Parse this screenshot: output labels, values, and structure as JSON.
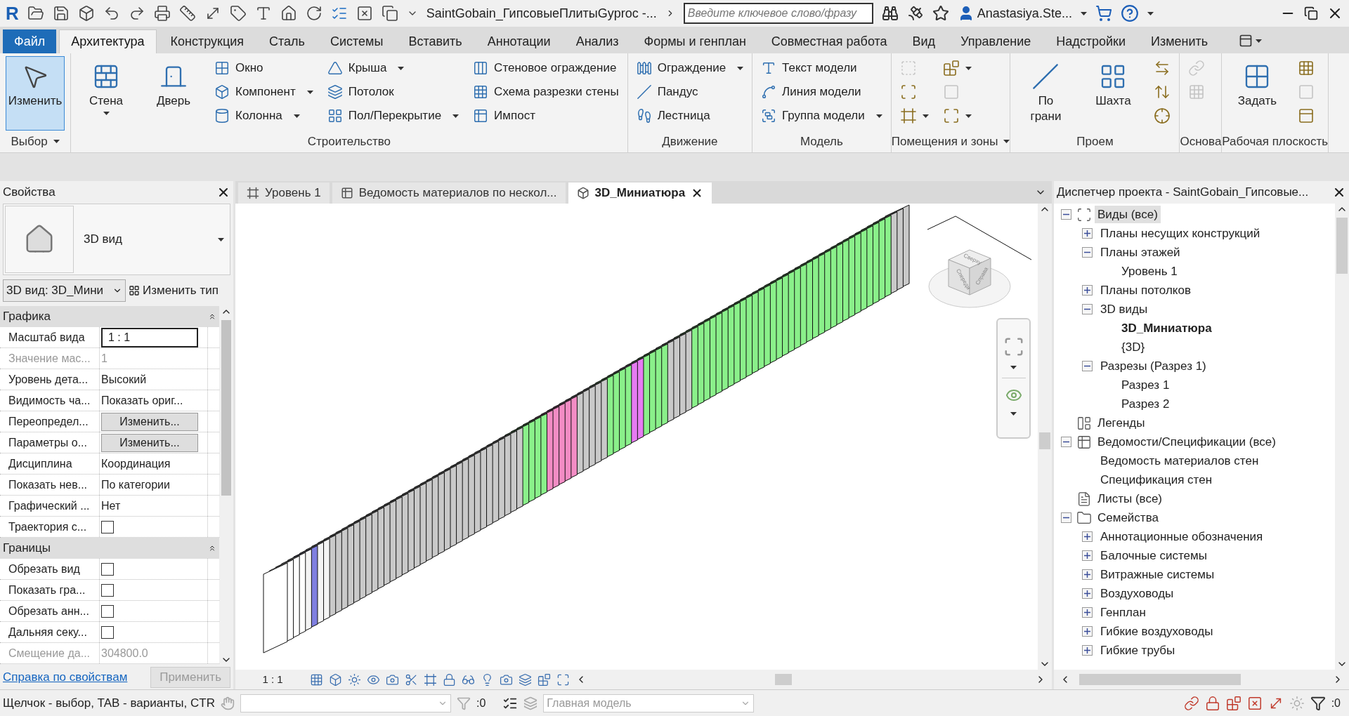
{
  "title_bar": {
    "app_logo": "R",
    "document": "SaintGobain_ГипсовыеПлитыGyproc -...",
    "search": {
      "placeholder": "Введите ключевое слово/фразу"
    },
    "user": "Anastasiya.Ste..."
  },
  "ribbon_tabs": [
    {
      "label": "Файл",
      "kind": "file",
      "selected": false
    },
    {
      "label": "Архитектура",
      "kind": "tab",
      "selected": true
    },
    {
      "label": "Конструкция",
      "kind": "tab",
      "selected": false
    },
    {
      "label": "Сталь",
      "kind": "tab",
      "selected": false
    },
    {
      "label": "Системы",
      "kind": "tab",
      "selected": false
    },
    {
      "label": "Вставить",
      "kind": "tab",
      "selected": false
    },
    {
      "label": "Аннотации",
      "kind": "tab",
      "selected": false
    },
    {
      "label": "Анализ",
      "kind": "tab",
      "selected": false
    },
    {
      "label": "Формы и генплан",
      "kind": "tab",
      "selected": false
    },
    {
      "label": "Совместная работа",
      "kind": "tab",
      "selected": false
    },
    {
      "label": "Вид",
      "kind": "tab",
      "selected": false
    },
    {
      "label": "Управление",
      "kind": "tab",
      "selected": false
    },
    {
      "label": "Надстройки",
      "kind": "tab",
      "selected": false
    },
    {
      "label": "Изменить",
      "kind": "tab",
      "selected": false
    }
  ],
  "ribbon_panels": [
    {
      "title": "Выбор",
      "menu": true,
      "tools": [
        {
          "label": "Изменить",
          "kind": "large",
          "dropdown": false,
          "active": true,
          "disabled": false
        }
      ]
    },
    {
      "title": "Строительство",
      "menu": false,
      "tools": [
        {
          "label": "Стена",
          "kind": "large",
          "dropdown": true,
          "active": false,
          "disabled": false
        },
        {
          "label": "Дверь",
          "kind": "large",
          "dropdown": false,
          "active": false,
          "disabled": false
        },
        {
          "label": "Окно",
          "kind": "small",
          "dropdown": false,
          "active": false,
          "disabled": false
        },
        {
          "label": "Компонент",
          "kind": "small",
          "dropdown": true,
          "active": false,
          "disabled": false
        },
        {
          "label": "Колонна",
          "kind": "small",
          "dropdown": true,
          "active": false,
          "disabled": false
        },
        {
          "label": "Крыша",
          "kind": "small",
          "dropdown": true,
          "active": false,
          "disabled": false
        },
        {
          "label": "Потолок",
          "kind": "small",
          "dropdown": false,
          "active": false,
          "disabled": false
        },
        {
          "label": "Пол/Перекрытие",
          "kind": "small",
          "dropdown": true,
          "active": false,
          "disabled": false
        },
        {
          "label": "Стеновое ограждение",
          "kind": "small",
          "dropdown": false,
          "active": false,
          "disabled": false
        },
        {
          "label": "Схема разрезки стены",
          "kind": "small",
          "dropdown": false,
          "active": false,
          "disabled": false
        },
        {
          "label": "Импост",
          "kind": "small",
          "dropdown": false,
          "active": false,
          "disabled": false
        }
      ]
    },
    {
      "title": "Движение",
      "menu": false,
      "tools": [
        {
          "label": "Ограждение",
          "kind": "small",
          "dropdown": true,
          "active": false,
          "disabled": false
        },
        {
          "label": "Пандус",
          "kind": "small",
          "dropdown": false,
          "active": false,
          "disabled": false
        },
        {
          "label": "Лестница",
          "kind": "small",
          "dropdown": false,
          "active": false,
          "disabled": false
        }
      ]
    },
    {
      "title": "Модель",
      "menu": false,
      "tools": [
        {
          "label": "Текст модели",
          "kind": "small",
          "dropdown": false,
          "active": false,
          "disabled": false
        },
        {
          "label": "Линия  модели",
          "kind": "small",
          "dropdown": false,
          "active": false,
          "disabled": false
        },
        {
          "label": "Группа модели",
          "kind": "small",
          "dropdown": true,
          "active": false,
          "disabled": false
        }
      ]
    },
    {
      "title": "Помещения и зоны",
      "menu": true,
      "tools": [
        {
          "kind": "icon",
          "dropdown": false,
          "active": false,
          "disabled": true
        },
        {
          "kind": "icon",
          "dropdown": false,
          "active": false,
          "disabled": false
        },
        {
          "kind": "icon",
          "dropdown": true,
          "active": false,
          "disabled": false
        },
        {
          "kind": "icon",
          "dropdown": true,
          "active": false,
          "disabled": false
        },
        {
          "kind": "icon",
          "dropdown": false,
          "active": false,
          "disabled": true
        },
        {
          "kind": "icon",
          "dropdown": true,
          "active": false,
          "disabled": false
        }
      ]
    },
    {
      "title": "Проем",
      "menu": false,
      "tools": [
        {
          "label": "По грани",
          "kind": "large",
          "dropdown": false,
          "active": false,
          "disabled": false
        },
        {
          "label": "Шахта",
          "kind": "large",
          "dropdown": false,
          "active": false,
          "disabled": false
        },
        {
          "kind": "icon",
          "dropdown": false,
          "active": false,
          "disabled": false
        },
        {
          "kind": "icon",
          "dropdown": false,
          "active": false,
          "disabled": false
        },
        {
          "kind": "icon",
          "dropdown": false,
          "active": false,
          "disabled": false
        }
      ]
    },
    {
      "title": "Основа",
      "menu": false,
      "tools": [
        {
          "kind": "icon",
          "dropdown": false,
          "active": false,
          "disabled": true
        },
        {
          "kind": "icon",
          "dropdown": false,
          "active": false,
          "disabled": true
        }
      ]
    },
    {
      "title": "Рабочая плоскость",
      "menu": false,
      "tools": [
        {
          "label": "Задать",
          "kind": "large",
          "dropdown": false,
          "active": false,
          "disabled": false
        },
        {
          "kind": "icon",
          "dropdown": false,
          "active": false,
          "disabled": false
        },
        {
          "kind": "icon",
          "dropdown": false,
          "active": false,
          "disabled": true
        },
        {
          "kind": "icon",
          "dropdown": false,
          "active": false,
          "disabled": false
        }
      ]
    }
  ],
  "properties": {
    "title": "Свойства",
    "type_name": "3D вид",
    "instance_select": "3D вид: 3D_Мини",
    "edit_type": "Изменить тип",
    "groups": [
      {
        "title": "Графика",
        "rows": [
          {
            "name": "Масштаб вида",
            "value": "1 : 1",
            "kind": "input",
            "disabled": false
          },
          {
            "name": "Значение мас...",
            "value": "1",
            "kind": "text",
            "disabled": true
          },
          {
            "name": "Уровень дета...",
            "value": "Высокий",
            "kind": "text",
            "disabled": false
          },
          {
            "name": "Видимость ча...",
            "value": "Показать ориг...",
            "kind": "text",
            "disabled": false
          },
          {
            "name": "Переопредел...",
            "value": "Изменить...",
            "kind": "button",
            "disabled": false
          },
          {
            "name": "Параметры о...",
            "value": "Изменить...",
            "kind": "button",
            "disabled": false
          },
          {
            "name": "Дисциплина",
            "value": "Координация",
            "kind": "text",
            "disabled": false
          },
          {
            "name": "Показать нев...",
            "value": "По категории",
            "kind": "text",
            "disabled": false
          },
          {
            "name": "Графический ...",
            "value": "Нет",
            "kind": "text",
            "disabled": false
          },
          {
            "name": "Траектория с...",
            "kind": "checkbox",
            "checked": false,
            "disabled": false
          }
        ]
      },
      {
        "title": "Границы",
        "rows": [
          {
            "name": "Обрезать вид",
            "kind": "checkbox",
            "checked": false,
            "disabled": false
          },
          {
            "name": "Показать гра...",
            "kind": "checkbox",
            "checked": false,
            "disabled": false
          },
          {
            "name": "Обрезать анн...",
            "kind": "checkbox",
            "checked": false,
            "disabled": false
          },
          {
            "name": "Дальняя секу...",
            "kind": "checkbox",
            "checked": false,
            "disabled": false
          },
          {
            "name": "Смещение да...",
            "value": "304800.0",
            "kind": "text",
            "disabled": true
          }
        ]
      }
    ],
    "help_link": "Справка по свойствам",
    "apply": {
      "label": "Применить",
      "disabled": true
    }
  },
  "view_tabs": [
    {
      "label": "Уровень 1",
      "kind": "plan",
      "selected": false
    },
    {
      "label": "Ведомость материалов по нескол...",
      "kind": "schedule",
      "selected": false
    },
    {
      "label": "3D_Миниатюра",
      "kind": "model",
      "selected": true
    }
  ],
  "view_cube": {
    "top": "Сверху",
    "front": "Спереди",
    "right": "Справа"
  },
  "view_bar": {
    "scale": "1 : 1"
  },
  "browser": {
    "title": "Диспетчер проекта - SaintGobain_Гипсовые...",
    "tree": [
      {
        "label": "Виды (все)",
        "kind": "views",
        "expanded": true,
        "selected": true,
        "current": false,
        "children": [
          {
            "label": "Планы несущих конструкций",
            "expanded": false,
            "selected": false,
            "current": false
          },
          {
            "label": "Планы этажей",
            "expanded": true,
            "selected": false,
            "current": false,
            "children": [
              {
                "label": "Уровень 1",
                "selected": false,
                "current": false
              }
            ]
          },
          {
            "label": "Планы потолков",
            "expanded": false,
            "selected": false,
            "current": false
          },
          {
            "label": "3D виды",
            "expanded": true,
            "selected": false,
            "current": false,
            "children": [
              {
                "label": "3D_Миниатюра",
                "selected": false,
                "current": true
              },
              {
                "label": "{3D}",
                "selected": false,
                "current": false
              }
            ]
          },
          {
            "label": "Разрезы (Разрез 1)",
            "expanded": true,
            "selected": false,
            "current": false,
            "children": [
              {
                "label": "Разрез 1",
                "selected": false,
                "current": false
              },
              {
                "label": "Разрез 2",
                "selected": false,
                "current": false
              }
            ]
          }
        ]
      },
      {
        "label": "Легенды",
        "kind": "legends",
        "selected": false,
        "current": false
      },
      {
        "label": "Ведомости/Спецификации (все)",
        "kind": "schedules",
        "expanded": true,
        "selected": false,
        "current": false,
        "children": [
          {
            "label": "Ведомость материалов стен",
            "selected": false,
            "current": false
          },
          {
            "label": "Спецификация стен",
            "selected": false,
            "current": false
          }
        ]
      },
      {
        "label": "Листы (все)",
        "kind": "sheets",
        "selected": false,
        "current": false
      },
      {
        "label": "Семейства",
        "kind": "families",
        "expanded": true,
        "selected": false,
        "current": false,
        "children": [
          {
            "label": "Аннотационные обозначения",
            "expanded": false,
            "selected": false,
            "current": false
          },
          {
            "label": "Балочные системы",
            "expanded": false,
            "selected": false,
            "current": false
          },
          {
            "label": "Витражные системы",
            "expanded": false,
            "selected": false,
            "current": false
          },
          {
            "label": "Воздуховоды",
            "expanded": false,
            "selected": false,
            "current": false
          },
          {
            "label": "Генплан",
            "expanded": false,
            "selected": false,
            "current": false
          },
          {
            "label": "Гибкие воздуховоды",
            "expanded": false,
            "selected": false,
            "current": false
          },
          {
            "label": "Гибкие трубы",
            "expanded": false,
            "selected": false,
            "current": false
          }
        ]
      }
    ]
  },
  "status_bar": {
    "hint": "Щелчок - выбор, TAB - варианты, CTR",
    "workset_count": ":0",
    "model": "Главная модель",
    "filter_count": ":0"
  }
}
